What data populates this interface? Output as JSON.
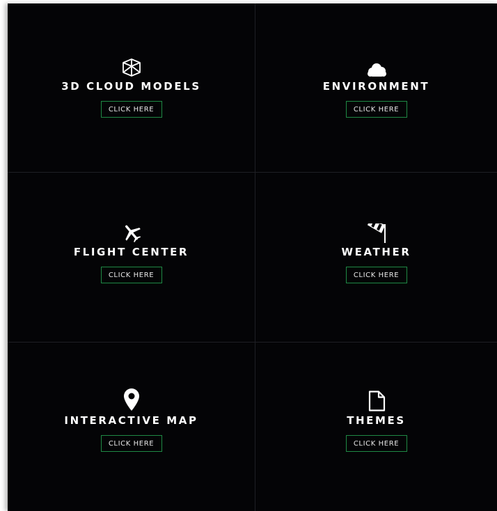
{
  "tiles": [
    {
      "title": "3D CLOUD MODELS",
      "button_label": "CLICK HERE",
      "icon": "cube-icon"
    },
    {
      "title": "ENVIRONMENT",
      "button_label": "CLICK HERE",
      "icon": "cloud-icon"
    },
    {
      "title": "FLIGHT CENTER",
      "button_label": "CLICK HERE",
      "icon": "airplane-icon"
    },
    {
      "title": "WEATHER",
      "button_label": "CLICK HERE",
      "icon": "windsock-icon"
    },
    {
      "title": "INTERACTIVE MAP",
      "button_label": "CLICK HERE",
      "icon": "map-pin-icon"
    },
    {
      "title": "THEMES",
      "button_label": "CLICK HERE",
      "icon": "document-icon"
    }
  ],
  "colors": {
    "background": "#040406",
    "divider": "#1e1f24",
    "button_border": "#1f8a45",
    "text": "#ffffff"
  }
}
